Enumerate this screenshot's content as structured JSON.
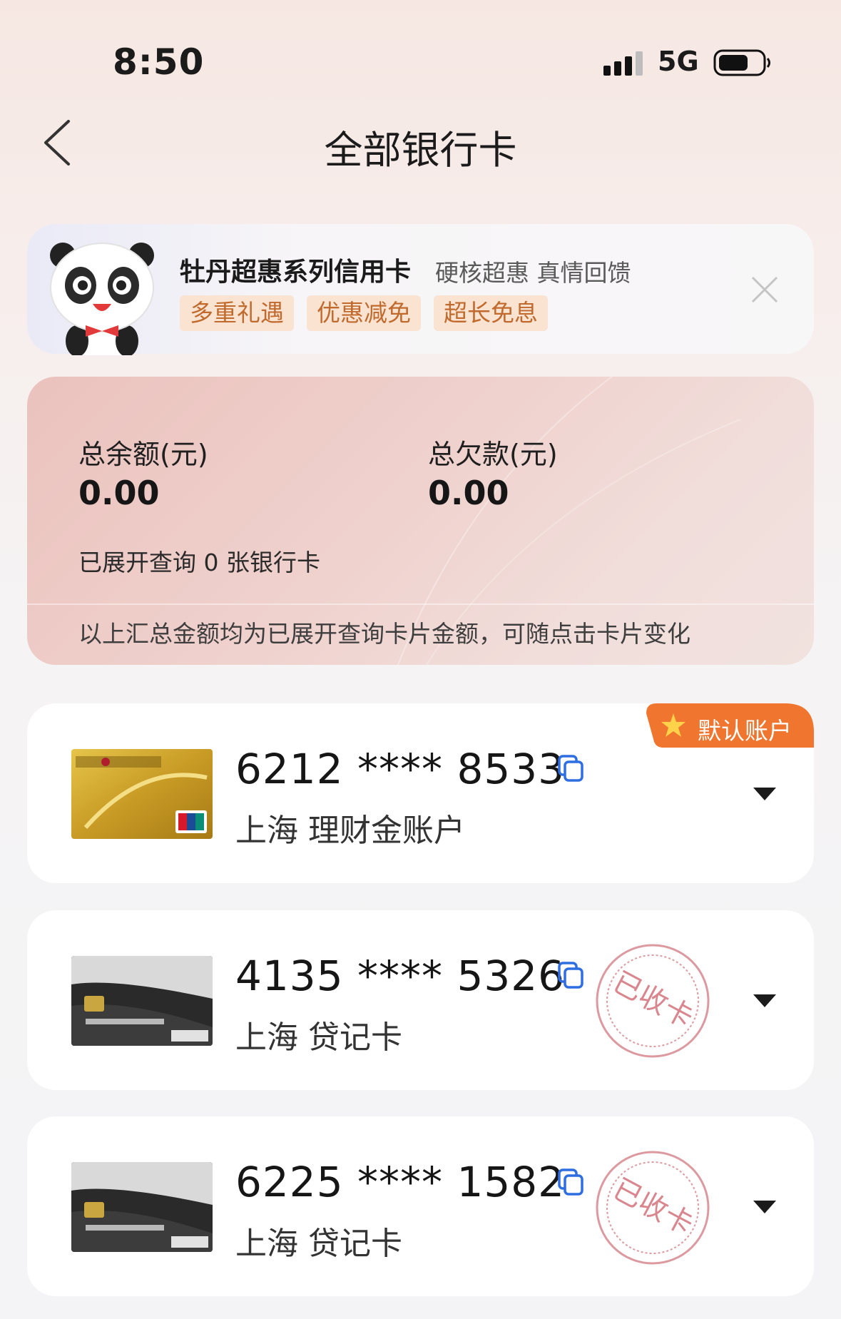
{
  "status_bar": {
    "time": "8:50",
    "network": "5G"
  },
  "header": {
    "title": "全部银行卡"
  },
  "promo": {
    "title": "牡丹超惠系列信用卡",
    "subtitle": "硬核超惠 真情回馈",
    "tags": [
      "多重礼遇",
      "优惠减免",
      "超长免息"
    ]
  },
  "summary": {
    "balance_label": "总余额(元)",
    "balance_value": "0.00",
    "debt_label": "总欠款(元)",
    "debt_value": "0.00",
    "expanded_text": "已展开查询 0 张银行卡",
    "note": "以上汇总金额均为已展开查询卡片金额，可随点击卡片变化"
  },
  "cards": [
    {
      "number": "6212 **** 8533",
      "description": "上海 理财金账户",
      "badge": "默认账户",
      "stamp": ""
    },
    {
      "number": "4135 **** 5326",
      "description": "上海 贷记卡",
      "badge": "",
      "stamp": "已收卡"
    },
    {
      "number": "6225 **** 1582",
      "description": "上海 贷记卡",
      "badge": "",
      "stamp": "已收卡"
    }
  ],
  "colors": {
    "accent_blue": "#2f6ee0",
    "badge_orange": "#f0752e",
    "stamp_red": "#d9868e"
  }
}
